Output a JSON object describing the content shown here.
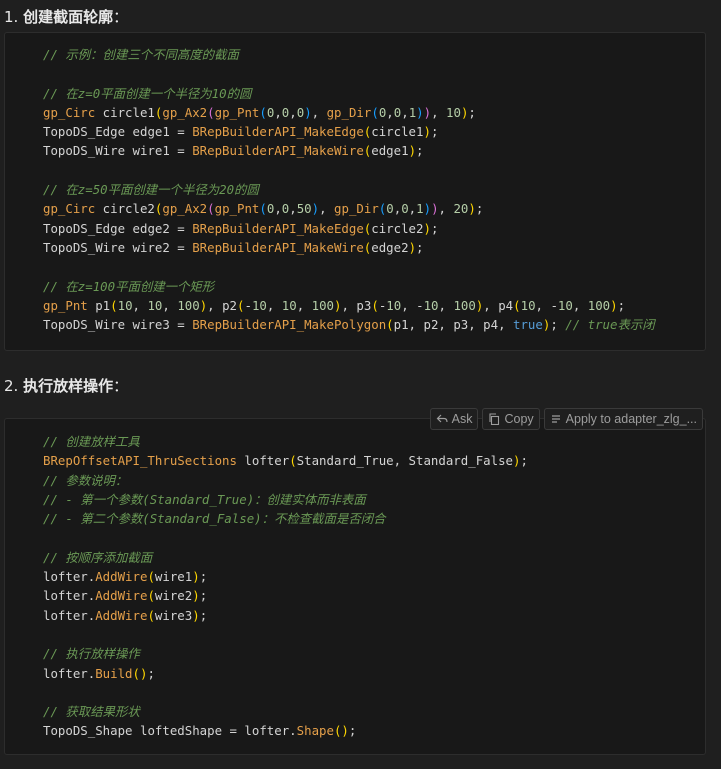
{
  "section1": {
    "number": "1.",
    "title": "创建截面轮廓",
    "suffix": "："
  },
  "section2": {
    "number": "2.",
    "title": "执行放样操作",
    "suffix": "："
  },
  "toolbar": {
    "ask_label": "Ask",
    "copy_label": "Copy",
    "apply_label": "Apply to adapter_zlg_..."
  },
  "code1": [
    [
      [
        "c",
        "// 示例：创建三个不同高度的截面"
      ]
    ],
    [],
    [
      [
        "c",
        "// 在z=0平面创建一个半径为10的圆"
      ]
    ],
    [
      [
        "cls",
        "gp_Circ"
      ],
      [
        "v",
        " circle1"
      ],
      [
        "p1",
        "("
      ],
      [
        "fn",
        "gp_Ax2"
      ],
      [
        "p2",
        "("
      ],
      [
        "fn",
        "gp_Pnt"
      ],
      [
        "p3",
        "("
      ],
      [
        "n",
        "0"
      ],
      [
        "v",
        ","
      ],
      [
        "n",
        "0"
      ],
      [
        "v",
        ","
      ],
      [
        "n",
        "0"
      ],
      [
        "p3",
        ")"
      ],
      [
        "v",
        ", "
      ],
      [
        "fn",
        "gp_Dir"
      ],
      [
        "p3",
        "("
      ],
      [
        "n",
        "0"
      ],
      [
        "v",
        ","
      ],
      [
        "n",
        "0"
      ],
      [
        "v",
        ","
      ],
      [
        "n",
        "1"
      ],
      [
        "p3",
        ")"
      ],
      [
        "p2",
        ")"
      ],
      [
        "v",
        ", "
      ],
      [
        "n",
        "10"
      ],
      [
        "p1",
        ")"
      ],
      [
        "v",
        ";"
      ]
    ],
    [
      [
        "ty",
        "TopoDS_Edge"
      ],
      [
        "v",
        " edge1 = "
      ],
      [
        "fn",
        "BRepBuilderAPI_MakeEdge"
      ],
      [
        "p1",
        "("
      ],
      [
        "v",
        "circle1"
      ],
      [
        "p1",
        ")"
      ],
      [
        "v",
        ";"
      ]
    ],
    [
      [
        "ty",
        "TopoDS_Wire"
      ],
      [
        "v",
        " wire1 = "
      ],
      [
        "fn",
        "BRepBuilderAPI_MakeWire"
      ],
      [
        "p1",
        "("
      ],
      [
        "v",
        "edge1"
      ],
      [
        "p1",
        ")"
      ],
      [
        "v",
        ";"
      ]
    ],
    [],
    [
      [
        "c",
        "// 在z=50平面创建一个半径为20的圆"
      ]
    ],
    [
      [
        "cls",
        "gp_Circ"
      ],
      [
        "v",
        " circle2"
      ],
      [
        "p1",
        "("
      ],
      [
        "fn",
        "gp_Ax2"
      ],
      [
        "p2",
        "("
      ],
      [
        "fn",
        "gp_Pnt"
      ],
      [
        "p3",
        "("
      ],
      [
        "n",
        "0"
      ],
      [
        "v",
        ","
      ],
      [
        "n",
        "0"
      ],
      [
        "v",
        ","
      ],
      [
        "n",
        "50"
      ],
      [
        "p3",
        ")"
      ],
      [
        "v",
        ", "
      ],
      [
        "fn",
        "gp_Dir"
      ],
      [
        "p3",
        "("
      ],
      [
        "n",
        "0"
      ],
      [
        "v",
        ","
      ],
      [
        "n",
        "0"
      ],
      [
        "v",
        ","
      ],
      [
        "n",
        "1"
      ],
      [
        "p3",
        ")"
      ],
      [
        "p2",
        ")"
      ],
      [
        "v",
        ", "
      ],
      [
        "n",
        "20"
      ],
      [
        "p1",
        ")"
      ],
      [
        "v",
        ";"
      ]
    ],
    [
      [
        "ty",
        "TopoDS_Edge"
      ],
      [
        "v",
        " edge2 = "
      ],
      [
        "fn",
        "BRepBuilderAPI_MakeEdge"
      ],
      [
        "p1",
        "("
      ],
      [
        "v",
        "circle2"
      ],
      [
        "p1",
        ")"
      ],
      [
        "v",
        ";"
      ]
    ],
    [
      [
        "ty",
        "TopoDS_Wire"
      ],
      [
        "v",
        " wire2 = "
      ],
      [
        "fn",
        "BRepBuilderAPI_MakeWire"
      ],
      [
        "p1",
        "("
      ],
      [
        "v",
        "edge2"
      ],
      [
        "p1",
        ")"
      ],
      [
        "v",
        ";"
      ]
    ],
    [],
    [
      [
        "c",
        "// 在z=100平面创建一个矩形"
      ]
    ],
    [
      [
        "cls",
        "gp_Pnt"
      ],
      [
        "v",
        " p1"
      ],
      [
        "p1",
        "("
      ],
      [
        "n",
        "10"
      ],
      [
        "v",
        ", "
      ],
      [
        "n",
        "10"
      ],
      [
        "v",
        ", "
      ],
      [
        "n",
        "100"
      ],
      [
        "p1",
        ")"
      ],
      [
        "v",
        ", p2"
      ],
      [
        "p1",
        "("
      ],
      [
        "v",
        "-"
      ],
      [
        "n",
        "10"
      ],
      [
        "v",
        ", "
      ],
      [
        "n",
        "10"
      ],
      [
        "v",
        ", "
      ],
      [
        "n",
        "100"
      ],
      [
        "p1",
        ")"
      ],
      [
        "v",
        ", p3"
      ],
      [
        "p1",
        "("
      ],
      [
        "v",
        "-"
      ],
      [
        "n",
        "10"
      ],
      [
        "v",
        ", -"
      ],
      [
        "n",
        "10"
      ],
      [
        "v",
        ", "
      ],
      [
        "n",
        "100"
      ],
      [
        "p1",
        ")"
      ],
      [
        "v",
        ", p4"
      ],
      [
        "p1",
        "("
      ],
      [
        "n",
        "10"
      ],
      [
        "v",
        ", -"
      ],
      [
        "n",
        "10"
      ],
      [
        "v",
        ", "
      ],
      [
        "n",
        "100"
      ],
      [
        "p1",
        ")"
      ],
      [
        "v",
        ";"
      ]
    ],
    [
      [
        "ty",
        "TopoDS_Wire"
      ],
      [
        "v",
        " wire3 = "
      ],
      [
        "fn",
        "BRepBuilderAPI_MakePolygon"
      ],
      [
        "p1",
        "("
      ],
      [
        "v",
        "p1, p2, p3, p4, "
      ],
      [
        "k",
        "true"
      ],
      [
        "p1",
        ")"
      ],
      [
        "v",
        "; "
      ],
      [
        "c",
        "// true表示闭"
      ]
    ]
  ],
  "code2": [
    [
      [
        "c",
        "// 创建放样工具"
      ]
    ],
    [
      [
        "fn",
        "BRepOffsetAPI_ThruSections"
      ],
      [
        "v",
        " lofter"
      ],
      [
        "p1",
        "("
      ],
      [
        "v",
        "Standard_True, Standard_False"
      ],
      [
        "p1",
        ")"
      ],
      [
        "v",
        ";"
      ]
    ],
    [
      [
        "c",
        "// 参数说明："
      ]
    ],
    [
      [
        "c",
        "// - 第一个参数(Standard_True)：创建实体而非表面"
      ]
    ],
    [
      [
        "c",
        "// - 第二个参数(Standard_False)：不检查截面是否闭合"
      ]
    ],
    [],
    [
      [
        "c",
        "// 按顺序添加截面"
      ]
    ],
    [
      [
        "v",
        "lofter."
      ],
      [
        "fn",
        "AddWire"
      ],
      [
        "p1",
        "("
      ],
      [
        "v",
        "wire1"
      ],
      [
        "p1",
        ")"
      ],
      [
        "v",
        ";"
      ]
    ],
    [
      [
        "v",
        "lofter."
      ],
      [
        "fn",
        "AddWire"
      ],
      [
        "p1",
        "("
      ],
      [
        "v",
        "wire2"
      ],
      [
        "p1",
        ")"
      ],
      [
        "v",
        ";"
      ]
    ],
    [
      [
        "v",
        "lofter."
      ],
      [
        "fn",
        "AddWire"
      ],
      [
        "p1",
        "("
      ],
      [
        "v",
        "wire3"
      ],
      [
        "p1",
        ")"
      ],
      [
        "v",
        ";"
      ]
    ],
    [],
    [
      [
        "c",
        "// 执行放样操作"
      ]
    ],
    [
      [
        "v",
        "lofter."
      ],
      [
        "fn",
        "Build"
      ],
      [
        "p1",
        "()"
      ],
      [
        "v",
        ";"
      ]
    ],
    [],
    [
      [
        "c",
        "// 获取结果形状"
      ]
    ],
    [
      [
        "ty",
        "TopoDS_Shape"
      ],
      [
        "v",
        " loftedShape = lofter."
      ],
      [
        "fn",
        "Shape"
      ],
      [
        "p1",
        "()"
      ],
      [
        "v",
        ";"
      ]
    ]
  ]
}
